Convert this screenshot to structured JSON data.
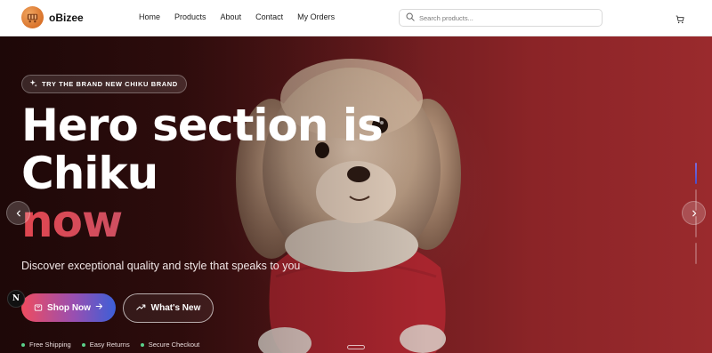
{
  "app": {
    "brand_name": "oBizee",
    "logo_icon": "shopping-cart-logo-icon",
    "accent_color": "#d9732b"
  },
  "nav": {
    "items": [
      "Home",
      "Products",
      "About",
      "Contact",
      "My Orders"
    ]
  },
  "search": {
    "placeholder": "Search products...",
    "value": "",
    "icon": "search-icon"
  },
  "cart": {
    "icon": "cart-icon"
  },
  "hero": {
    "badge_label": "TRY THE BRAND NEW CHIKU BRAND",
    "badge_icon": "sparkles-icon",
    "headline_line1": "Hero section is",
    "headline_line2": "Chiku",
    "headline_accent": "now",
    "subtitle": "Discover exceptional quality and style that speaks to you",
    "primary_button": {
      "label": "Shop Now",
      "icon": "shopping-bag-icon",
      "trailing_icon": "arrow-right-icon"
    },
    "secondary_button": {
      "label": "What's New",
      "icon": "trending-up-icon"
    },
    "features": [
      "Free Shipping",
      "Easy Returns",
      "Secure Checkout"
    ],
    "feature_dot_color": "#5ad08a",
    "slide_count": 4,
    "active_slide": 1
  },
  "dev_badge": {
    "label": "N"
  }
}
